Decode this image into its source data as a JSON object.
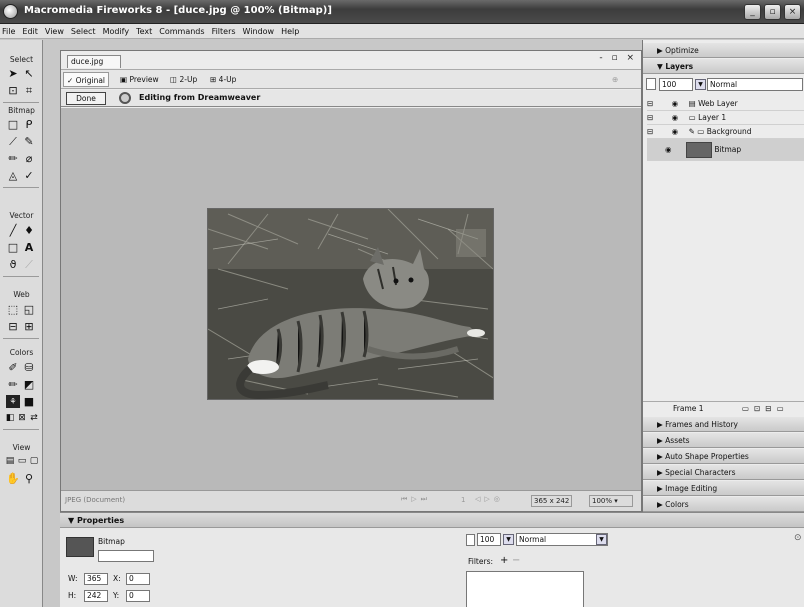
{
  "app_title": "Macromedia Fireworks 8 - [duce.jpg @ 100% (Bitmap)]",
  "menu": [
    "File",
    "Edit",
    "View",
    "Select",
    "Modify",
    "Text",
    "Commands",
    "Filters",
    "Window",
    "Help"
  ],
  "tools": {
    "select_label": "Select",
    "bitmap_label": "Bitmap",
    "vector_label": "Vector",
    "web_label": "Web",
    "colors_label": "Colors",
    "view_label": "View"
  },
  "document": {
    "tab_name": "duce.jpg",
    "view_tabs": [
      "Original",
      "Preview",
      "2-Up",
      "4-Up"
    ],
    "done_label": "Done",
    "editing_text": "Editing from Dreamweaver",
    "status": {
      "format": "JPEG (Document)",
      "frame": "1",
      "size": "365 x 242",
      "zoom": "100%"
    }
  },
  "panels": {
    "optimize": "Optimize",
    "layers": "Layers",
    "opacity": "100",
    "blend": "Normal",
    "layer_items": [
      "Web Layer",
      "Layer 1",
      "Background",
      "Bitmap"
    ],
    "frame_label": "Frame 1",
    "collapsed": [
      "Frames and History",
      "Assets",
      "Auto Shape Properties",
      "Special Characters",
      "Image Editing",
      "Colors"
    ]
  },
  "properties": {
    "header": "Properties",
    "object_type": "Bitmap",
    "w_label": "W:",
    "w_value": "365",
    "x_label": "X:",
    "x_value": "0",
    "h_label": "H:",
    "h_value": "242",
    "y_label": "Y:",
    "y_value": "0",
    "opacity": "100",
    "blend": "Normal",
    "filters_label": "Filters:"
  }
}
